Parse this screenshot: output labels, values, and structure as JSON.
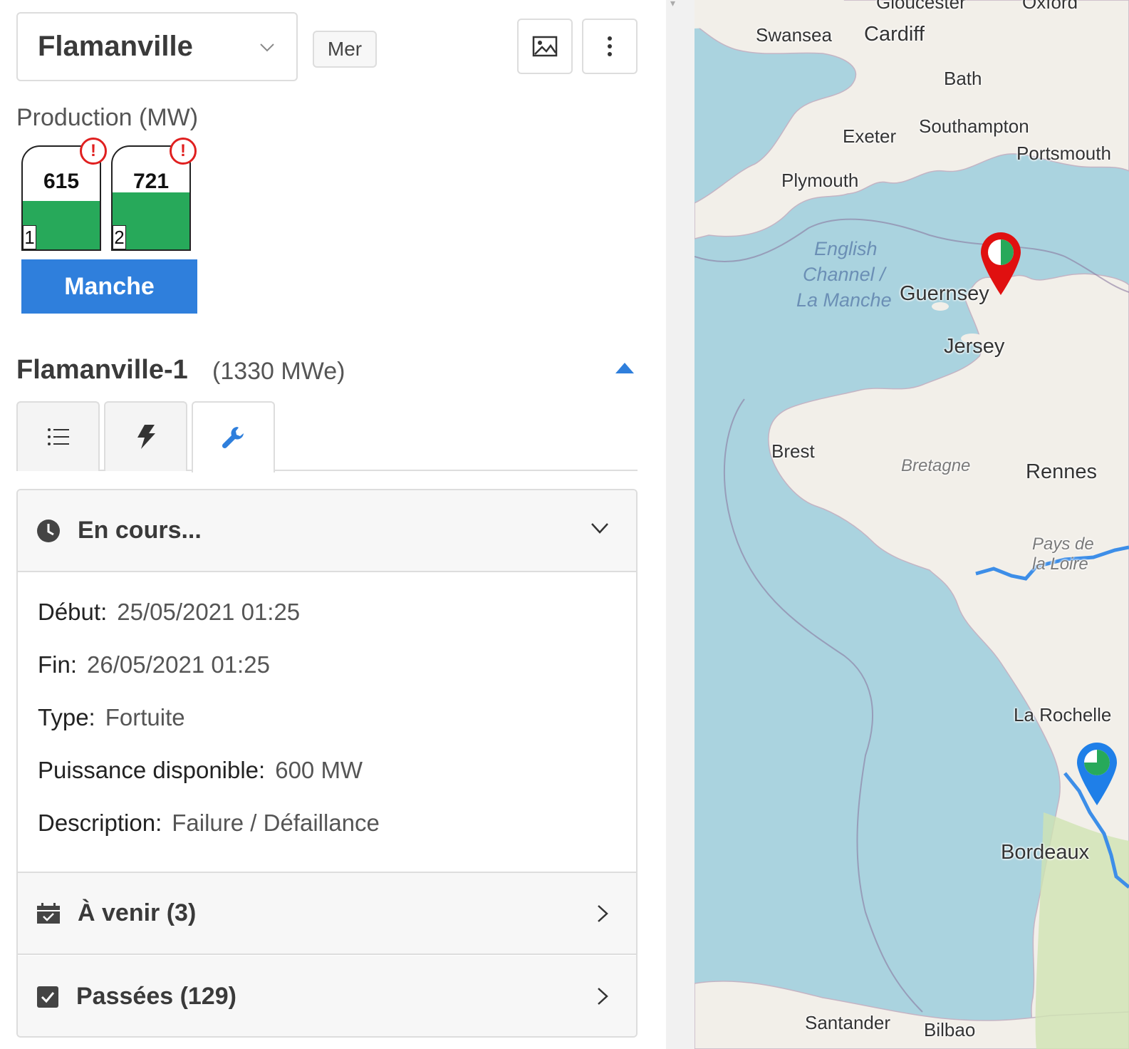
{
  "header": {
    "site_name": "Flamanville",
    "tag": "Mer",
    "image_button_icon": "image-icon",
    "more_button_icon": "more-vertical-icon"
  },
  "production": {
    "label": "Production (MW)",
    "units": [
      {
        "index": "1",
        "value": "615",
        "fill_fraction": 0.46,
        "alert": "!"
      },
      {
        "index": "2",
        "value": "721",
        "fill_fraction": 0.54,
        "alert": "!"
      }
    ],
    "region_button": "Manche",
    "fill_color": "#27a95a"
  },
  "unit": {
    "title": "Flamanville-1",
    "capacity": "(1330 MWe)",
    "tabs": [
      {
        "icon": "list-icon",
        "active": false
      },
      {
        "icon": "lightning-icon",
        "active": false
      },
      {
        "icon": "wrench-icon",
        "active": true
      }
    ]
  },
  "events": {
    "current": {
      "title": "En cours...",
      "icon": "clock-icon",
      "fields": [
        {
          "key": "Début",
          "sep": ":",
          "value": "25/05/2021 01:25"
        },
        {
          "key": "Fin",
          "sep": ":",
          "value": "26/05/2021 01:25"
        },
        {
          "key": "Type",
          "sep": ":",
          "value": "Fortuite"
        },
        {
          "key": "Puissance disponible",
          "sep": ":",
          "value": "600 MW"
        },
        {
          "key": "Description",
          "sep": ":",
          "value": "Failure / Défaillance"
        }
      ]
    },
    "upcoming": {
      "title": "À venir (3)",
      "icon": "calendar-check-icon"
    },
    "past": {
      "title": "Passées (129)",
      "icon": "checkbox-icon"
    }
  },
  "map": {
    "labels": {
      "gloucester": "Gloucester",
      "oxford": "Oxford",
      "swansea": "Swansea",
      "cardiff": "Cardiff",
      "bath": "Bath",
      "exeter": "Exeter",
      "southampton": "Southampton",
      "portsmouth": "Portsmouth",
      "plymouth": "Plymouth",
      "sea1": "English",
      "sea2": "Channel /",
      "sea3": "La Manche",
      "guernsey": "Guernsey",
      "jersey": "Jersey",
      "brest": "Brest",
      "bretagne": "Bretagne",
      "rennes": "Rennes",
      "pays1": "Pays de",
      "pays2": "la Loire",
      "larochelle": "La Rochelle",
      "bordeaux": "Bordeaux",
      "santander": "Santander",
      "bilbao": "Bilbao"
    },
    "red_marker_color": "#e01010",
    "blue_marker_color": "#1f7fe8",
    "river_color": "#3d8ee8"
  }
}
